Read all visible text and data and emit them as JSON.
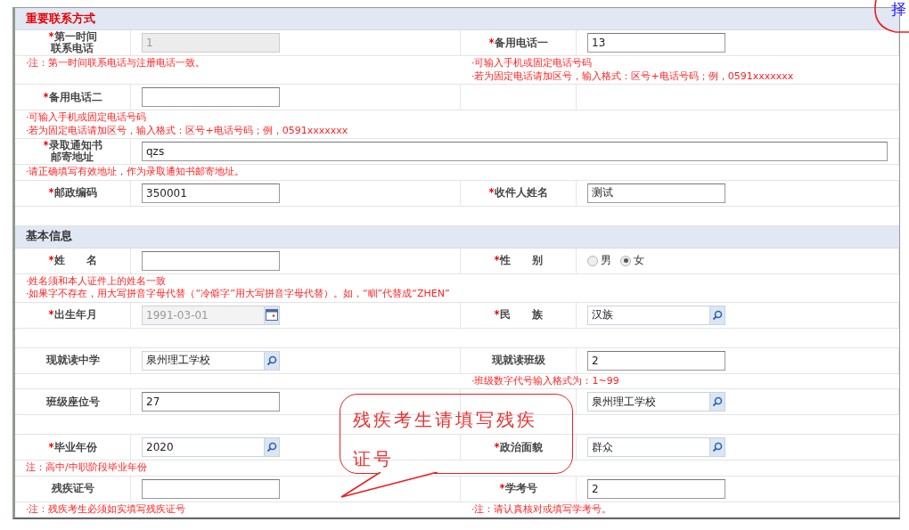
{
  "sections": [
    {
      "title": "重要联系方式",
      "emphasis": true,
      "rows": [
        {
          "kind": "fields",
          "cells": [
            {
              "asterisk": "*",
              "label": [
                "第一时间",
                "联系电话"
              ],
              "field": {
                "kind": "text",
                "value": "1",
                "disabled": true
              }
            },
            {
              "asterisk": "*",
              "label": [
                "备用电话一"
              ],
              "field": {
                "kind": "text",
                "value": "13",
                "disabled": false
              }
            }
          ]
        },
        {
          "kind": "notes",
          "left": [
            "·注：第一时间联系电话与注册电话一致。"
          ],
          "right": [
            "·可输入手机或固定电话号码",
            "·若为固定电话请加区号，输入格式：区号+电话号码；例，0591xxxxxxx"
          ]
        },
        {
          "kind": "fields",
          "cells": [
            {
              "asterisk": "*",
              "label": [
                "备用电话二"
              ],
              "field": {
                "kind": "text",
                "disabled": false
              }
            }
          ]
        },
        {
          "kind": "full_note",
          "lines": [
            "·可输入手机或固定电话号码",
            "·若为固定电话请加区号，输入格式：区号+电话号码；例，0591xxxxxxx"
          ]
        },
        {
          "kind": "fields",
          "wide": true,
          "cells": [
            {
              "asterisk": "*",
              "label": [
                "录取通知书",
                "邮寄地址"
              ],
              "field": {
                "kind": "text",
                "value": "qzs",
                "disabled": false
              }
            }
          ]
        },
        {
          "kind": "full_note",
          "lines": [
            "·请正确填写有效地址，作为录取通知书邮寄地址。"
          ]
        },
        {
          "kind": "fields",
          "cells": [
            {
              "asterisk": "*",
              "label": [
                "邮政编码"
              ],
              "field": {
                "kind": "text",
                "value": "350001",
                "disabled": false
              }
            },
            {
              "asterisk": "*",
              "label": [
                "收件人姓名"
              ],
              "field": {
                "kind": "text",
                "value": "测试",
                "disabled": false
              }
            }
          ]
        },
        {
          "kind": "blank"
        }
      ]
    },
    {
      "title": "基本信息",
      "emphasis": false,
      "rows": [
        {
          "kind": "fields",
          "cells": [
            {
              "asterisk": "*",
              "label": [
                "姓　　名"
              ],
              "field": {
                "kind": "text",
                "disabled": false
              }
            },
            {
              "asterisk": "*",
              "label": [
                "性　　别"
              ],
              "field": {
                "kind": "radio",
                "options": [
                  {
                    "label": "男",
                    "selected": false
                  },
                  {
                    "label": "女",
                    "selected": true
                  }
                ]
              }
            }
          ]
        },
        {
          "kind": "full_note",
          "lines": [
            "·姓名须和本人证件上的姓名一致",
            "·如果字不存在，用大写拼音字母代替（“冷僻字”用大写拼音字母代替）。如，“甽”代替成“ZHEN”"
          ]
        },
        {
          "kind": "fields",
          "cells": [
            {
              "asterisk": "*",
              "label": [
                "出生年月"
              ],
              "field": {
                "kind": "date",
                "value": "1991-03-01",
                "disabled": true
              }
            },
            {
              "asterisk": "*",
              "label": [
                "民　　族"
              ],
              "field": {
                "kind": "search",
                "value": "汉族"
              }
            }
          ]
        },
        {
          "kind": "blank"
        },
        {
          "kind": "fields",
          "cells": [
            {
              "label": [
                "现就读中学"
              ],
              "field": {
                "kind": "search",
                "value": "泉州理工学校"
              }
            },
            {
              "label": [
                "现就读班级"
              ],
              "field": {
                "kind": "text",
                "value": "2",
                "disabled": false
              }
            }
          ]
        },
        {
          "kind": "notes",
          "right": [
            "·班级数字代号输入格式为：1~99"
          ]
        },
        {
          "kind": "fields",
          "cells": [
            {
              "label": [
                "班级座位号"
              ],
              "field": {
                "kind": "text",
                "value": "27",
                "disabled": false
              }
            },
            {
              "field": {
                "kind": "search",
                "value": "泉州理工学校"
              }
            }
          ]
        },
        {
          "kind": "blank"
        },
        {
          "kind": "fields",
          "cells": [
            {
              "asterisk": "*",
              "label": [
                "毕业年份"
              ],
              "field": {
                "kind": "search",
                "value": "2020"
              }
            },
            {
              "asterisk": "*",
              "label": [
                "政治面貌"
              ],
              "field": {
                "kind": "search",
                "value": "群众"
              }
            }
          ]
        },
        {
          "kind": "full_note",
          "lines": [
            "注：高中/中职阶段毕业年份"
          ]
        },
        {
          "kind": "fields",
          "cells": [
            {
              "label": [
                "残疾证号"
              ],
              "field": {
                "kind": "text",
                "disabled": false
              }
            },
            {
              "asterisk": "*",
              "label": [
                "学考号"
              ],
              "field": {
                "kind": "text",
                "value": "2",
                "disabled": false
              }
            }
          ]
        },
        {
          "kind": "notes",
          "left": [
            "·注：残疾考生必须如实填写残疾证号"
          ],
          "right": [
            "·注：请认真核对或填写学考号。"
          ]
        }
      ]
    }
  ],
  "callout": {
    "text": "残疾考生请填写残疾证号"
  },
  "corner_annotation": {
    "text": "择"
  }
}
